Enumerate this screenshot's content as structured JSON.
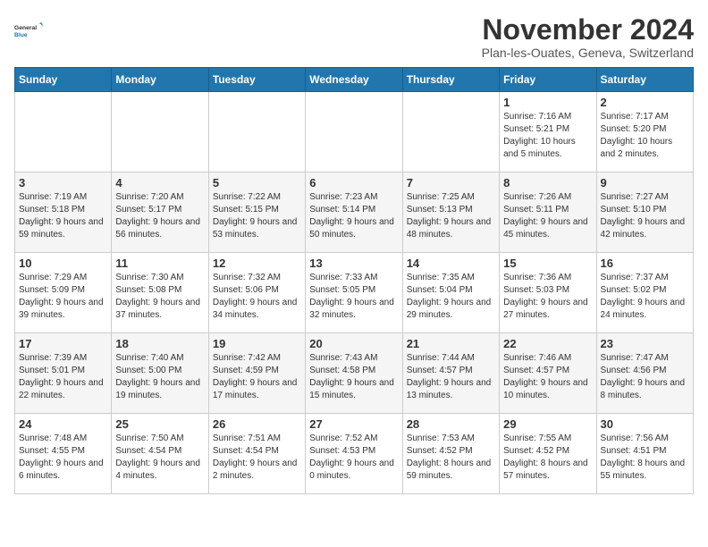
{
  "logo": {
    "text_general": "General",
    "text_blue": "Blue"
  },
  "header": {
    "month_title": "November 2024",
    "subtitle": "Plan-les-Ouates, Geneva, Switzerland"
  },
  "weekdays": [
    "Sunday",
    "Monday",
    "Tuesday",
    "Wednesday",
    "Thursday",
    "Friday",
    "Saturday"
  ],
  "weeks": [
    [
      {
        "day": "",
        "info": ""
      },
      {
        "day": "",
        "info": ""
      },
      {
        "day": "",
        "info": ""
      },
      {
        "day": "",
        "info": ""
      },
      {
        "day": "",
        "info": ""
      },
      {
        "day": "1",
        "info": "Sunrise: 7:16 AM\nSunset: 5:21 PM\nDaylight: 10 hours and 5 minutes."
      },
      {
        "day": "2",
        "info": "Sunrise: 7:17 AM\nSunset: 5:20 PM\nDaylight: 10 hours and 2 minutes."
      }
    ],
    [
      {
        "day": "3",
        "info": "Sunrise: 7:19 AM\nSunset: 5:18 PM\nDaylight: 9 hours and 59 minutes."
      },
      {
        "day": "4",
        "info": "Sunrise: 7:20 AM\nSunset: 5:17 PM\nDaylight: 9 hours and 56 minutes."
      },
      {
        "day": "5",
        "info": "Sunrise: 7:22 AM\nSunset: 5:15 PM\nDaylight: 9 hours and 53 minutes."
      },
      {
        "day": "6",
        "info": "Sunrise: 7:23 AM\nSunset: 5:14 PM\nDaylight: 9 hours and 50 minutes."
      },
      {
        "day": "7",
        "info": "Sunrise: 7:25 AM\nSunset: 5:13 PM\nDaylight: 9 hours and 48 minutes."
      },
      {
        "day": "8",
        "info": "Sunrise: 7:26 AM\nSunset: 5:11 PM\nDaylight: 9 hours and 45 minutes."
      },
      {
        "day": "9",
        "info": "Sunrise: 7:27 AM\nSunset: 5:10 PM\nDaylight: 9 hours and 42 minutes."
      }
    ],
    [
      {
        "day": "10",
        "info": "Sunrise: 7:29 AM\nSunset: 5:09 PM\nDaylight: 9 hours and 39 minutes."
      },
      {
        "day": "11",
        "info": "Sunrise: 7:30 AM\nSunset: 5:08 PM\nDaylight: 9 hours and 37 minutes."
      },
      {
        "day": "12",
        "info": "Sunrise: 7:32 AM\nSunset: 5:06 PM\nDaylight: 9 hours and 34 minutes."
      },
      {
        "day": "13",
        "info": "Sunrise: 7:33 AM\nSunset: 5:05 PM\nDaylight: 9 hours and 32 minutes."
      },
      {
        "day": "14",
        "info": "Sunrise: 7:35 AM\nSunset: 5:04 PM\nDaylight: 9 hours and 29 minutes."
      },
      {
        "day": "15",
        "info": "Sunrise: 7:36 AM\nSunset: 5:03 PM\nDaylight: 9 hours and 27 minutes."
      },
      {
        "day": "16",
        "info": "Sunrise: 7:37 AM\nSunset: 5:02 PM\nDaylight: 9 hours and 24 minutes."
      }
    ],
    [
      {
        "day": "17",
        "info": "Sunrise: 7:39 AM\nSunset: 5:01 PM\nDaylight: 9 hours and 22 minutes."
      },
      {
        "day": "18",
        "info": "Sunrise: 7:40 AM\nSunset: 5:00 PM\nDaylight: 9 hours and 19 minutes."
      },
      {
        "day": "19",
        "info": "Sunrise: 7:42 AM\nSunset: 4:59 PM\nDaylight: 9 hours and 17 minutes."
      },
      {
        "day": "20",
        "info": "Sunrise: 7:43 AM\nSunset: 4:58 PM\nDaylight: 9 hours and 15 minutes."
      },
      {
        "day": "21",
        "info": "Sunrise: 7:44 AM\nSunset: 4:57 PM\nDaylight: 9 hours and 13 minutes."
      },
      {
        "day": "22",
        "info": "Sunrise: 7:46 AM\nSunset: 4:57 PM\nDaylight: 9 hours and 10 minutes."
      },
      {
        "day": "23",
        "info": "Sunrise: 7:47 AM\nSunset: 4:56 PM\nDaylight: 9 hours and 8 minutes."
      }
    ],
    [
      {
        "day": "24",
        "info": "Sunrise: 7:48 AM\nSunset: 4:55 PM\nDaylight: 9 hours and 6 minutes."
      },
      {
        "day": "25",
        "info": "Sunrise: 7:50 AM\nSunset: 4:54 PM\nDaylight: 9 hours and 4 minutes."
      },
      {
        "day": "26",
        "info": "Sunrise: 7:51 AM\nSunset: 4:54 PM\nDaylight: 9 hours and 2 minutes."
      },
      {
        "day": "27",
        "info": "Sunrise: 7:52 AM\nSunset: 4:53 PM\nDaylight: 9 hours and 0 minutes."
      },
      {
        "day": "28",
        "info": "Sunrise: 7:53 AM\nSunset: 4:52 PM\nDaylight: 8 hours and 59 minutes."
      },
      {
        "day": "29",
        "info": "Sunrise: 7:55 AM\nSunset: 4:52 PM\nDaylight: 8 hours and 57 minutes."
      },
      {
        "day": "30",
        "info": "Sunrise: 7:56 AM\nSunset: 4:51 PM\nDaylight: 8 hours and 55 minutes."
      }
    ]
  ]
}
